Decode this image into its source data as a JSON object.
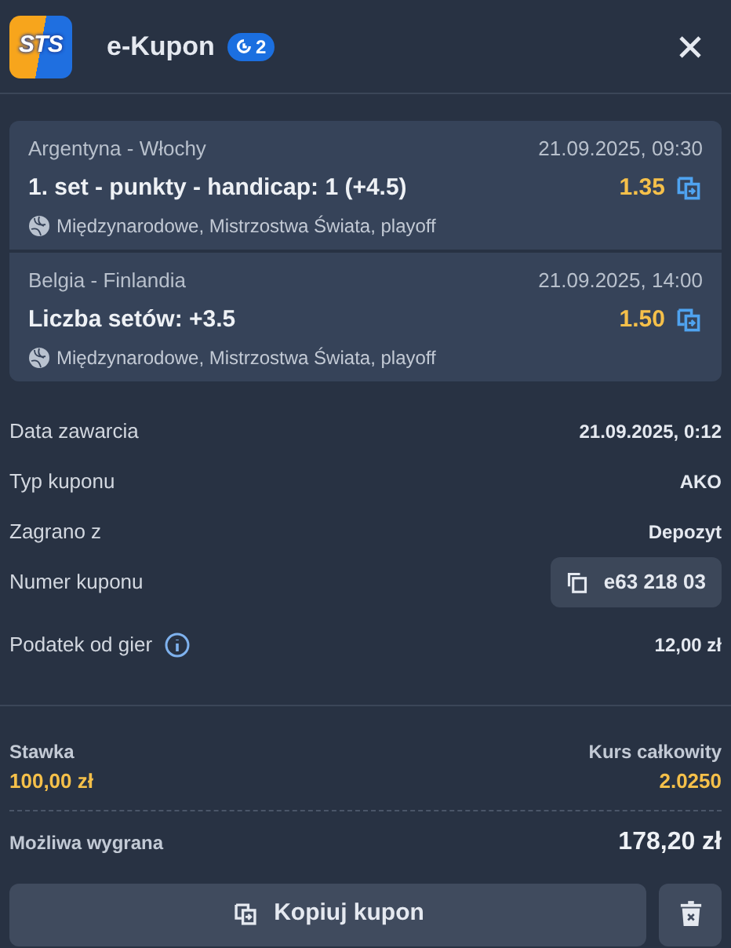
{
  "header": {
    "logo_text": "STS",
    "title": "e-Kupon",
    "badge": "2"
  },
  "bets": [
    {
      "match": "Argentyna - Włochy",
      "datetime": "21.09.2025, 09:30",
      "selection": "1. set - punkty - handicap: 1 (+4.5)",
      "odds": "1.35",
      "league": "Międzynarodowe, Mistrzostwa Świata, playoff"
    },
    {
      "match": "Belgia - Finlandia",
      "datetime": "21.09.2025, 14:00",
      "selection": "Liczba setów: +3.5",
      "odds": "1.50",
      "league": "Międzynarodowe, Mistrzostwa Świata, playoff"
    }
  ],
  "details": [
    {
      "kind": "text",
      "label": "Data zawarcia",
      "value": "21.09.2025, 0:12"
    },
    {
      "kind": "text",
      "label": "Typ kuponu",
      "value": "AKO"
    },
    {
      "kind": "text",
      "label": "Zagrano z",
      "value": "Depozyt"
    },
    {
      "kind": "copy",
      "label": "Numer kuponu",
      "value": "e63 218 03"
    },
    {
      "kind": "info",
      "label": "Podatek od gier",
      "value": "12,00 zł"
    }
  ],
  "summary": {
    "stake_label": "Stawka",
    "stake": "100,00 zł",
    "total_odds_label": "Kurs całkowity",
    "total_odds": "2.0250",
    "win_label": "Możliwa wygrana",
    "win": "178,20 zł"
  },
  "actions": {
    "copy_button": "Kopiuj kupon"
  }
}
